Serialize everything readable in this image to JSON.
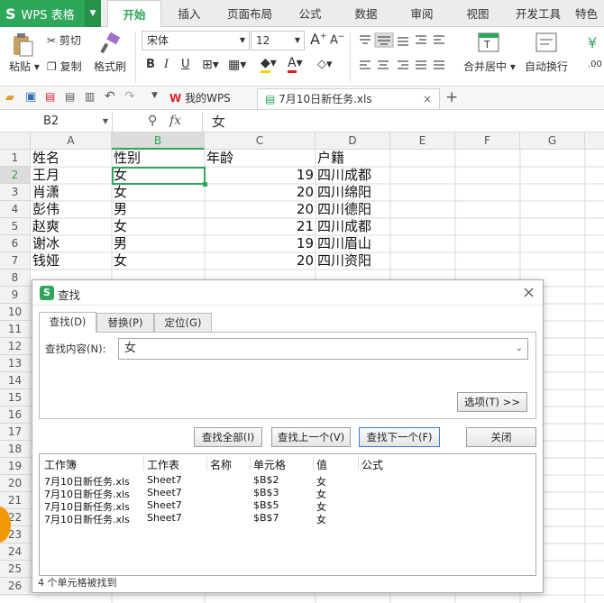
{
  "app": {
    "name": "WPS 表格",
    "logo": "S"
  },
  "menu": {
    "tabs": [
      "开始",
      "插入",
      "页面布局",
      "公式",
      "数据",
      "审阅",
      "视图",
      "开发工具",
      "特色"
    ]
  },
  "ribbon": {
    "paste": "粘贴",
    "cut": "剪切",
    "copy": "复制",
    "format_painter": "格式刷",
    "font_name": "宋体",
    "font_size": "12",
    "merge_center": "合并居中",
    "auto_wrap": "自动换行"
  },
  "doc_tabs": {
    "home": "我的WPS",
    "file": "7月10日新任务.xls"
  },
  "formula_bar": {
    "name_box": "B2",
    "fx": "fx",
    "value": "女"
  },
  "sheet": {
    "columns": [
      "A",
      "B",
      "C",
      "D",
      "E",
      "F",
      "G"
    ],
    "row_numbers": [
      "1",
      "2",
      "3",
      "4",
      "5",
      "6",
      "7",
      "8",
      "9",
      "10",
      "11",
      "12",
      "13",
      "14",
      "15",
      "16",
      "17",
      "18",
      "19",
      "20",
      "21",
      "22",
      "23",
      "24",
      "25",
      "26"
    ],
    "header": [
      "姓名",
      "性别",
      "年龄",
      "户籍"
    ],
    "rows": [
      [
        "王月",
        "女",
        "19",
        "四川成都"
      ],
      [
        "肖潇",
        "女",
        "20",
        "四川绵阳"
      ],
      [
        "彭伟",
        "男",
        "20",
        "四川德阳"
      ],
      [
        "赵爽",
        "女",
        "21",
        "四川成都"
      ],
      [
        "谢冰",
        "男",
        "19",
        "四川眉山"
      ],
      [
        "钱娅",
        "女",
        "20",
        "四川资阳"
      ]
    ]
  },
  "dialog": {
    "title": "查找",
    "tabs": [
      "查找(D)",
      "替换(P)",
      "定位(G)"
    ],
    "find_label": "查找内容(N):",
    "find_value": "女",
    "options_btn": "选项(T) >>",
    "find_all": "查找全部(I)",
    "find_prev": "查找上一个(V)",
    "find_next": "查找下一个(F)",
    "close": "关闭",
    "result_headers": [
      "工作簿",
      "工作表",
      "名称",
      "单元格",
      "值",
      "公式"
    ],
    "results": [
      [
        "7月10日新任务.xls",
        "Sheet7",
        "",
        "$B$2",
        "女",
        ""
      ],
      [
        "7月10日新任务.xls",
        "Sheet7",
        "",
        "$B$3",
        "女",
        ""
      ],
      [
        "7月10日新任务.xls",
        "Sheet7",
        "",
        "$B$5",
        "女",
        ""
      ],
      [
        "7月10日新任务.xls",
        "Sheet7",
        "",
        "$B$7",
        "女",
        ""
      ]
    ],
    "status": "4 个单元格被找到"
  },
  "colors": {
    "brand": "#2fa75a",
    "selection": "#2fa75a",
    "badge": "#f39800"
  }
}
